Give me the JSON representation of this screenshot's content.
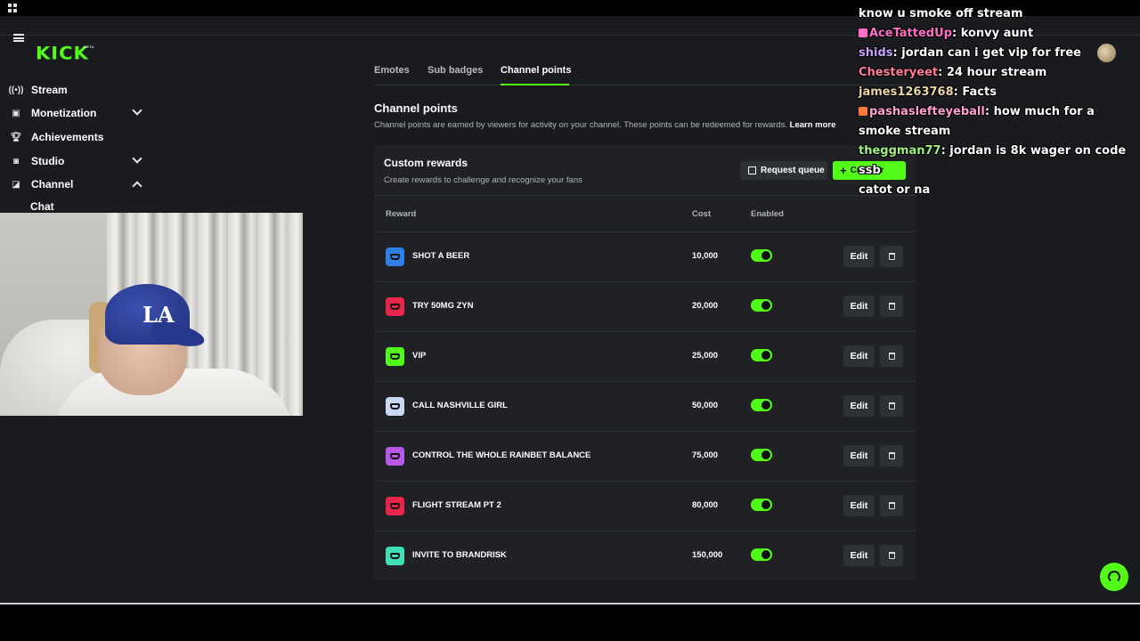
{
  "header": {
    "logo": "KICK",
    "logo_badge": "BETA"
  },
  "sidebar": {
    "items": [
      {
        "label": "Stream",
        "icon": "broadcast-icon"
      },
      {
        "label": "Monetization",
        "icon": "wallet-icon",
        "expandable": true
      },
      {
        "label": "Achievements",
        "icon": "trophy-icon"
      },
      {
        "label": "Studio",
        "icon": "camera-icon",
        "expandable": true
      },
      {
        "label": "Channel",
        "icon": "channel-icon",
        "expanded": true
      }
    ],
    "sub_item": "Chat"
  },
  "tabs": [
    {
      "label": "Emotes"
    },
    {
      "label": "Sub badges"
    },
    {
      "label": "Channel points",
      "active": true
    }
  ],
  "channel_points": {
    "title": "Channel points",
    "description": "Channel points are earned by viewers for activity on your channel. These points can be redeemed for rewards.",
    "learn_more": "Learn more"
  },
  "custom_rewards": {
    "title": "Custom rewards",
    "subtitle": "Create rewards to challenge and recognize your fans",
    "request_queue_label": "Request queue",
    "create_label": "Create r",
    "columns": {
      "reward": "Reward",
      "cost": "Cost",
      "enabled": "Enabled"
    },
    "edit_label": "Edit",
    "rows": [
      {
        "name": "SHOT A BEER",
        "cost": "10,000",
        "color": "#2f7fe8",
        "enabled": true
      },
      {
        "name": "TRY 50MG ZYN",
        "cost": "20,000",
        "color": "#e8254a",
        "enabled": true
      },
      {
        "name": "VIP",
        "cost": "25,000",
        "color": "#53fc18",
        "enabled": true
      },
      {
        "name": "CALL NASHVILLE GIRL",
        "cost": "50,000",
        "color": "#c8d7f2",
        "enabled": true
      },
      {
        "name": "CONTROL THE WHOLE RAINBET BALANCE",
        "cost": "75,000",
        "color": "#b858e8",
        "enabled": true
      },
      {
        "name": "FLIGHT STREAM PT 2",
        "cost": "80,000",
        "color": "#e8254a",
        "enabled": true
      },
      {
        "name": "INVITE TO BRANDRISK",
        "cost": "150,000",
        "color": "#3fe0b8",
        "enabled": true
      }
    ]
  },
  "chat": {
    "messages": [
      {
        "user": "",
        "text": "know u smoke off stream",
        "color": "#ffffff"
      },
      {
        "user": "AceTattedUp",
        "text": "konvy aunt",
        "color": "#ff6ec7",
        "badge": "#ff6ec7"
      },
      {
        "user": "shids",
        "text": "jordan can i get vip for free",
        "color": "#c9a0ff"
      },
      {
        "user": "Chesteryeet",
        "text": "24 hour stream",
        "color": "#ff7a9a"
      },
      {
        "user": "james1263768",
        "text": "Facts",
        "color": "#e9d3a0"
      },
      {
        "user": "pashasleftеyeball",
        "text": "how much for a smoke stream",
        "color": "#ff9fd0",
        "badge": "#ff7a3a"
      },
      {
        "user": "theggman77",
        "text": "jordan is 8k wager on code ssb",
        "color": "#a0f080"
      },
      {
        "user": "",
        "text": "catot or na",
        "color": "#ffffff"
      }
    ]
  },
  "colors": {
    "accent": "#53fc18",
    "background": "#191b1f",
    "panel": "#1f2125"
  }
}
